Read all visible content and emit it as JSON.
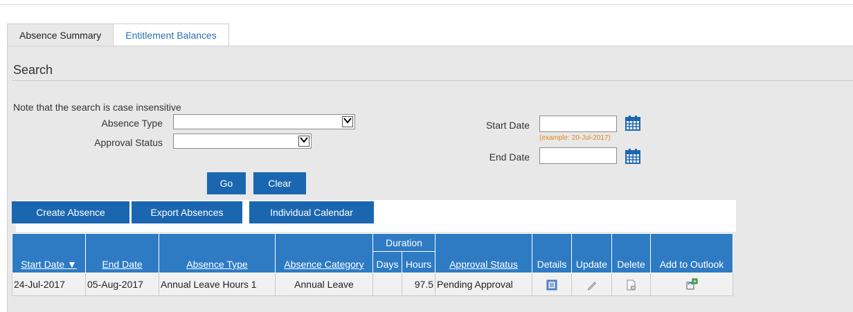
{
  "tabs": [
    {
      "label": "Absence Summary",
      "active": true
    },
    {
      "label": "Entitlement Balances",
      "active": false
    }
  ],
  "search": {
    "title": "Search",
    "note": "Note that the search is case insensitive",
    "absence_type_label": "Absence Type",
    "absence_type_value": "",
    "approval_status_label": "Approval Status",
    "approval_status_value": "",
    "start_date_label": "Start Date",
    "start_date_value": "",
    "date_example": "(example: 20-Jul-2017)",
    "end_date_label": "End Date",
    "end_date_value": "",
    "go_label": "Go",
    "clear_label": "Clear"
  },
  "toolbar": {
    "create_label": "Create Absence",
    "export_label": "Export Absences",
    "calendar_label": "Individual Calendar"
  },
  "table": {
    "duration_group": "Duration",
    "columns": {
      "start_date": "Start Date",
      "end_date": "End Date",
      "absence_type": "Absence Type",
      "absence_category": "Absence Category",
      "days": "Days",
      "hours": "Hours",
      "approval_status": "Approval Status",
      "details": "Details",
      "update": "Update",
      "delete": "Delete",
      "add_to_outlook": "Add to Outlook"
    },
    "sort_indicator": "▼",
    "rows": [
      {
        "start_date": "24-Jul-2017",
        "end_date": "05-Aug-2017",
        "absence_type": "Annual Leave Hours 1",
        "absence_category": "Annual Leave",
        "days": "",
        "hours": "97.5",
        "approval_status": "Pending Approval"
      }
    ]
  },
  "icons": {
    "calendar": "calendar-icon",
    "details": "details-icon",
    "update": "pencil-icon",
    "delete": "delete-icon",
    "outlook": "outlook-export-icon"
  },
  "colors": {
    "button_blue": "#1b66b0",
    "header_blue": "#2e7bc4",
    "link_blue": "#2a6fb5",
    "example_orange": "#e0861a"
  }
}
